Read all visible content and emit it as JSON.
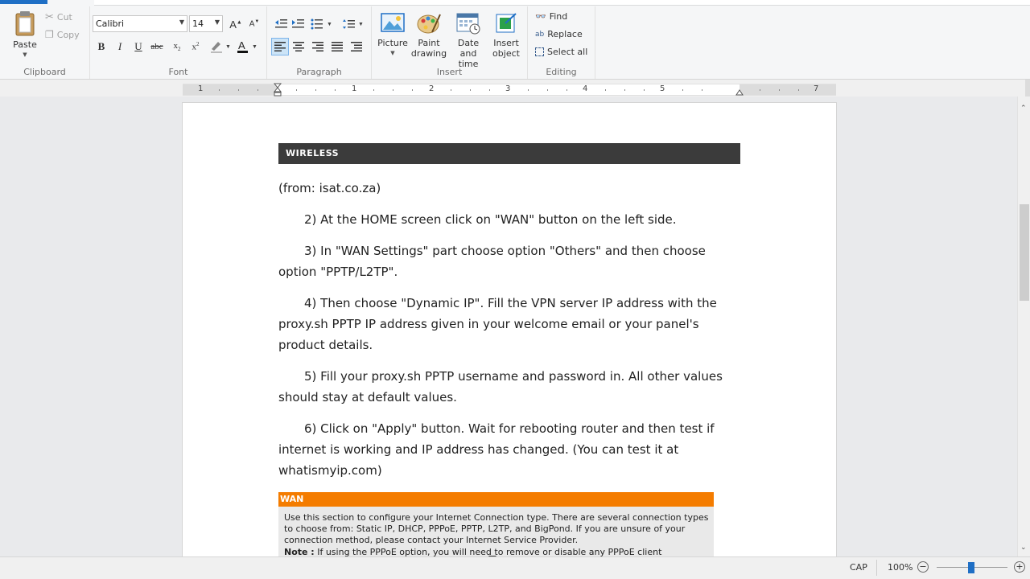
{
  "ribbon": {
    "clipboard": {
      "label": "Clipboard",
      "paste": "Paste",
      "cut": "Cut",
      "copy": "Copy"
    },
    "font": {
      "label": "Font",
      "family": "Calibri",
      "size": "14"
    },
    "paragraph": {
      "label": "Paragraph"
    },
    "insert": {
      "label": "Insert",
      "picture": "Picture",
      "paint1": "Paint",
      "paint2": "drawing",
      "date1": "Date and",
      "date2": "time",
      "obj1": "Insert",
      "obj2": "object"
    },
    "editing": {
      "label": "Editing",
      "find": "Find",
      "replace": "Replace",
      "select_all": "Select all"
    }
  },
  "ruler": {
    "numbers": [
      "1",
      "1",
      "2",
      "3",
      "4",
      "5",
      "7"
    ]
  },
  "document": {
    "banner": "WIRELESS",
    "source": "(from: isat.co.za)",
    "step2": "2) At the HOME screen click on \"WAN\" button on the left side.",
    "step3": "3) In \"WAN Settings\" part choose option \"Others\" and then choose option \"PPTP/L2TP\".",
    "step4": "4) Then choose \"Dynamic IP\". Fill the VPN server IP address with the proxy.sh PPTP IP address given in your  welcome email or your panel's product details.",
    "step5": "5) Fill your proxy.sh PPTP username and password in. All other values should stay at default values.",
    "step6": "6) Click on \"Apply\" button. Wait for rebooting router and then test if internet is working and IP address has changed. (You can test it at whatismyip.com)",
    "wan_title": "WAN",
    "wan_text": "Use this section to configure your Internet Connection type. There are several connection types to choose from: Static IP, DHCP, PPPoE, PPTP, L2TP, and BigPond. If you are unsure of your connection method, please contact your Internet Service Provider.",
    "wan_note_label": "Note :",
    "wan_note": "If using the PPPoE option, you will need to remove or disable any PPPoE client"
  },
  "status": {
    "caps": "CAP",
    "zoom": "100%",
    "zoom_level_percent": 100
  },
  "colors": {
    "accent": "#1f6fc5",
    "banner": "#3b3b3b",
    "wan_header": "#f47c00"
  }
}
